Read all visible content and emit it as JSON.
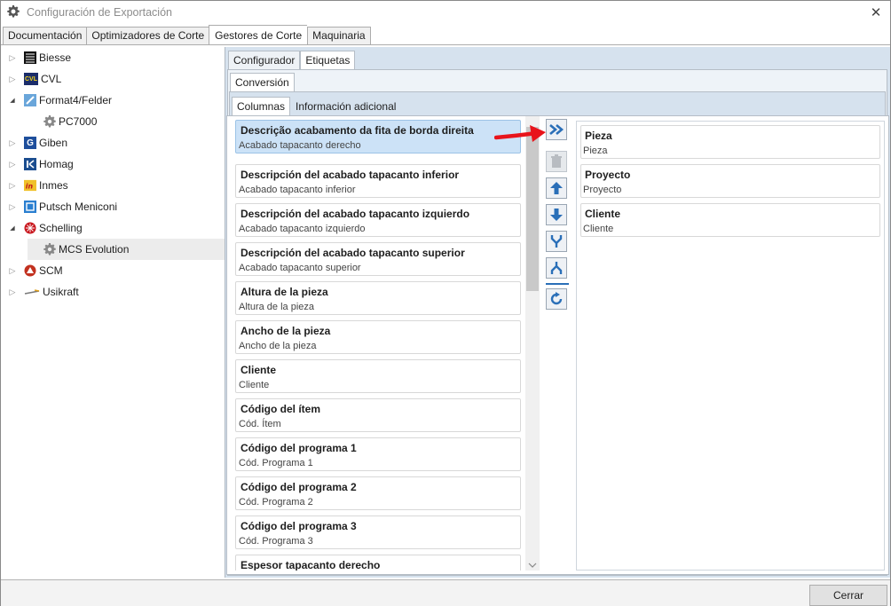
{
  "window": {
    "title": "Configuración de Exportación",
    "close_glyph": "✕"
  },
  "main_tabs": [
    "Documentación",
    "Optimizadores de Corte",
    "Gestores de Corte",
    "Maquinaria"
  ],
  "tree": {
    "items": [
      {
        "label": "Biesse",
        "icon": "biesse-logo-icon",
        "expander": "▷"
      },
      {
        "label": "CVL",
        "icon": "cvl-logo-icon",
        "expander": "▷",
        "badge": "CVL"
      },
      {
        "label": "Format4/Felder",
        "icon": "format4-logo-icon",
        "expander": "◢"
      },
      {
        "label": "PC7000",
        "icon": "gear-icon",
        "expander": ""
      },
      {
        "label": "Giben",
        "icon": "giben-logo-icon",
        "expander": "▷",
        "badge": "G"
      },
      {
        "label": "Homag",
        "icon": "homag-logo-icon",
        "expander": "▷"
      },
      {
        "label": "Inmes",
        "icon": "inmes-logo-icon",
        "expander": "▷"
      },
      {
        "label": "Putsch Meniconi",
        "icon": "putsch-logo-icon",
        "expander": "▷"
      },
      {
        "label": "Schelling",
        "icon": "schelling-logo-icon",
        "expander": "◢"
      },
      {
        "label": "MCS Evolution",
        "icon": "gear-icon",
        "expander": ""
      },
      {
        "label": "SCM",
        "icon": "scm-logo-icon",
        "expander": "▷"
      },
      {
        "label": "Usikraft",
        "icon": "usikraft-logo-icon",
        "expander": "▷"
      }
    ]
  },
  "sub_tabs": {
    "level1": [
      "Configurador",
      "Etiquetas"
    ],
    "level2": [
      "Conversión"
    ],
    "level3": [
      "Columnas",
      "Información adicional"
    ]
  },
  "available_columns": [
    {
      "title": "Descrição acabamento da fita de borda direita",
      "subtitle": "Acabado tapacanto derecho"
    },
    {
      "title": "Descripción del acabado tapacanto inferior",
      "subtitle": "Acabado tapacanto inferior"
    },
    {
      "title": "Descripción del acabado tapacanto izquierdo",
      "subtitle": "Acabado tapacanto izquierdo"
    },
    {
      "title": "Descripción del acabado tapacanto superior",
      "subtitle": "Acabado tapacanto superior"
    },
    {
      "title": "Altura de la pieza",
      "subtitle": "Altura de la pieza"
    },
    {
      "title": "Ancho de la pieza",
      "subtitle": "Ancho de la pieza"
    },
    {
      "title": "Cliente",
      "subtitle": "Cliente"
    },
    {
      "title": "Código del ítem",
      "subtitle": "Cód. Ítem"
    },
    {
      "title": "Código del programa 1",
      "subtitle": "Cód. Programa 1"
    },
    {
      "title": "Código del programa 2",
      "subtitle": "Cód. Programa 2"
    },
    {
      "title": "Código del programa 3",
      "subtitle": "Cód. Programa 3"
    },
    {
      "title": "Espesor tapacanto derecho",
      "subtitle": ""
    }
  ],
  "selected_columns": [
    {
      "title": "Pieza",
      "subtitle": "Pieza"
    },
    {
      "title": "Proyecto",
      "subtitle": "Proyecto"
    },
    {
      "title": "Cliente",
      "subtitle": "Cliente"
    }
  ],
  "action_buttons": [
    "add-columns-icon",
    "delete-icon",
    "move-up-icon",
    "move-down-icon",
    "merge-icon",
    "split-icon",
    "refresh-icon"
  ],
  "footer": {
    "close_label": "Cerrar"
  },
  "colors": {
    "accent": "#2a6fb8",
    "selected": "#cce2f7",
    "panel": "#d6e2ee",
    "annotation": "#e8141b"
  }
}
